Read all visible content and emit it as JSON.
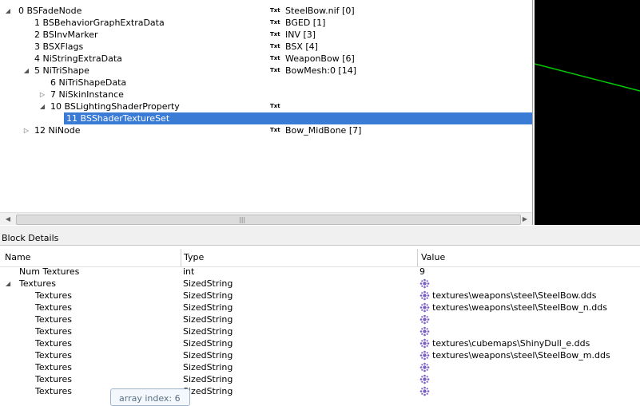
{
  "tree": {
    "rows": [
      {
        "label": "0 BSFadeNode",
        "toggle": "◢",
        "txt": "Txt",
        "value": "SteelBow.nif [0]"
      },
      {
        "label": "1 BSBehaviorGraphExtraData",
        "toggle": "",
        "txt": "Txt",
        "value": "BGED [1]"
      },
      {
        "label": "2 BSInvMarker",
        "toggle": "",
        "txt": "Txt",
        "value": "INV [3]"
      },
      {
        "label": "3 BSXFlags",
        "toggle": "",
        "txt": "Txt",
        "value": "BSX [4]"
      },
      {
        "label": "4 NiStringExtraData",
        "toggle": "",
        "txt": "Txt",
        "value": "WeaponBow [6]"
      },
      {
        "label": "5 NiTriShape",
        "toggle": "◢",
        "txt": "Txt",
        "value": "BowMesh:0 [14]"
      },
      {
        "label": "6 NiTriShapeData",
        "toggle": "",
        "txt": "",
        "value": ""
      },
      {
        "label": "7 NiSkinInstance",
        "toggle": "▷",
        "txt": "",
        "value": ""
      },
      {
        "label": "10 BSLightingShaderProperty",
        "toggle": "◢",
        "txt": "Txt",
        "value": ""
      },
      {
        "label": "11 BSShaderTextureSet",
        "toggle": "",
        "txt": "",
        "value": ""
      },
      {
        "label": "12 NiNode",
        "toggle": "▷",
        "txt": "Txt",
        "value": "Bow_MidBone [7]"
      }
    ],
    "scroll_grip": "|||"
  },
  "block_details": {
    "title": "Block Details",
    "columns": {
      "name": "Name",
      "type": "Type",
      "value": "Value"
    },
    "rows": [
      {
        "name": "Num Textures",
        "type": "int",
        "value": "9"
      },
      {
        "name": "Textures",
        "type": "SizedString",
        "value": ""
      },
      {
        "name": "Textures",
        "type": "SizedString",
        "value": "textures\\weapons\\steel\\SteelBow.dds"
      },
      {
        "name": "Textures",
        "type": "SizedString",
        "value": "textures\\weapons\\steel\\SteelBow_n.dds"
      },
      {
        "name": "Textures",
        "type": "SizedString",
        "value": ""
      },
      {
        "name": "Textures",
        "type": "SizedString",
        "value": ""
      },
      {
        "name": "Textures",
        "type": "SizedString",
        "value": "textures\\cubemaps\\ShinyDull_e.dds"
      },
      {
        "name": "Textures",
        "type": "SizedString",
        "value": "textures\\weapons\\steel\\SteelBow_m.dds"
      },
      {
        "name": "Textures",
        "type": "SizedString",
        "value": ""
      },
      {
        "name": "Textures",
        "type": "SizedString",
        "value": ""
      },
      {
        "name": "Textures",
        "type": "SizedString",
        "value": ""
      }
    ],
    "tooltip": "array index: 6"
  },
  "colors": {
    "selection": "#3a7bd5",
    "view_bg": "#000000",
    "view_line": "#00cc00"
  }
}
